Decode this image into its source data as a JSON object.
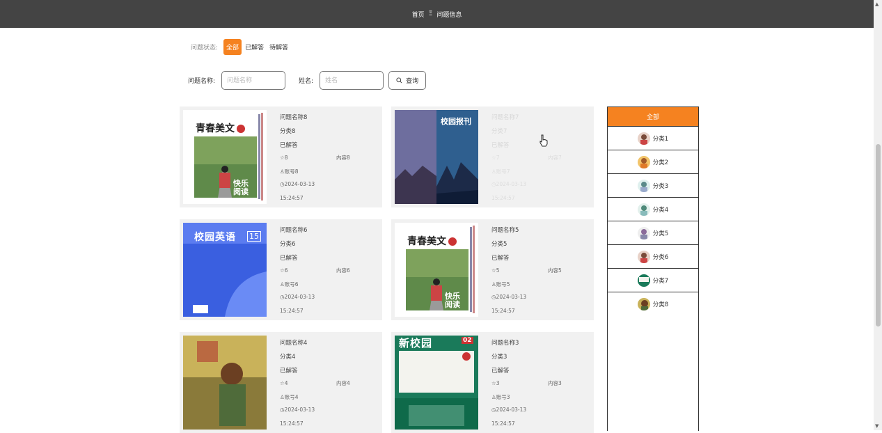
{
  "breadcrumb": {
    "home": "首页",
    "separator": "Ξ",
    "current": "问题信息"
  },
  "filter": {
    "label": "问题状态:",
    "options": [
      "全部",
      "已解答",
      "待解答"
    ],
    "active_index": 0
  },
  "search": {
    "name_label": "问题名称:",
    "name_placeholder": "问题名称",
    "user_label": "姓名:",
    "user_placeholder": "姓名",
    "button_label": "查询"
  },
  "cards": [
    {
      "title": "问题名称8",
      "category": "分类8",
      "status": "已解答",
      "stars": "8",
      "content": "内容8",
      "account": "账号8",
      "date": "2024-03-13",
      "time": "15:24:57"
    },
    {
      "title": "问题名称7",
      "category": "分类7",
      "status": "已解答",
      "stars": "7",
      "content": "内容7",
      "account": "账号7",
      "date": "2024-03-13",
      "time": "15:24:57"
    },
    {
      "title": "问题名称6",
      "category": "分类6",
      "status": "已解答",
      "stars": "6",
      "content": "内容6",
      "account": "账号6",
      "date": "2024-03-13",
      "time": "15:24:57"
    },
    {
      "title": "问题名称5",
      "category": "分类5",
      "status": "已解答",
      "stars": "5",
      "content": "内容5",
      "account": "账号5",
      "date": "2024-03-13",
      "time": "15:24:57"
    },
    {
      "title": "问题名称4",
      "category": "分类4",
      "status": "已解答",
      "stars": "4",
      "content": "内容4",
      "account": "账号4",
      "date": "2024-03-13",
      "time": "15:24:57"
    },
    {
      "title": "问题名称3",
      "category": "分类3",
      "status": "已解答",
      "stars": "3",
      "content": "内容3",
      "account": "账号3",
      "date": "2024-03-13",
      "time": "15:24:57"
    }
  ],
  "covers": {
    "qcmw": {
      "title": "青春美文",
      "badge": "快乐阅读"
    },
    "xybk": {
      "title": "校园报刊"
    },
    "xyyy": {
      "title": "校园英语",
      "num": "15"
    },
    "xxy": {
      "title": "新校园",
      "num": "02"
    }
  },
  "sidebar": {
    "header": "全部",
    "items": [
      "分类1",
      "分类2",
      "分类3",
      "分类4",
      "分类5",
      "分类6",
      "分类7",
      "分类8"
    ]
  },
  "colors": {
    "accent": "#f58220",
    "topbar": "#444444",
    "card_bg": "#f1f1f1"
  }
}
